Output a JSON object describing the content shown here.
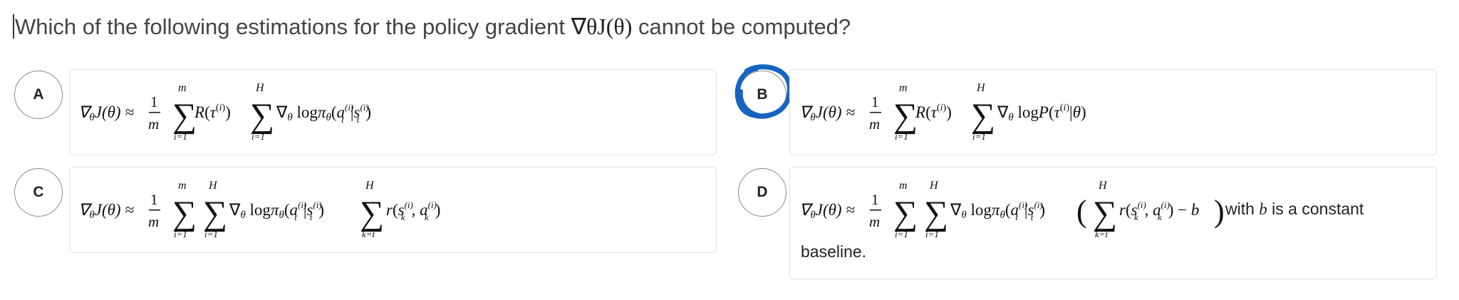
{
  "question": {
    "text_before": "Which of the following estimations for the policy gradient ",
    "math": "∇θJ(θ)",
    "text_after": " cannot be computed?"
  },
  "options": [
    {
      "letter": "A",
      "formula": "∇θJ(θ) ≈ (1/m) Σ_{i=1}^{m} R(τ^(i)) Σ_{i=1}^{H} ∇θ logπθ(a_t^(i)|s_t^(i))"
    },
    {
      "letter": "B",
      "formula": "∇θJ(θ) ≈ (1/m) Σ_{i=1}^{m} R(τ^(i)) Σ_{i=1}^{H} ∇θ logP(τ^(i)|θ)",
      "marked": true
    },
    {
      "letter": "C",
      "formula": "∇θJ(θ) ≈ (1/m) Σ_{i=1}^{m} Σ_{i=1}^{H} ∇θ logπθ(a_t^(i)|s_t^(i)) Σ_{k=t}^{H} r(s_k^(i), a_k^(i))"
    },
    {
      "letter": "D",
      "formula": "∇θJ(θ) ≈ (1/m) Σ_{i=1}^{m} Σ_{i=1}^{H} ∇θ logπθ(a_t^(i)|s_t^(i)) ( Σ_{k=t}^{H} r(s_k^(i), a_k^(i)) − b )",
      "suffix_pre": "with ",
      "suffix_var": "b",
      "suffix_post": " is a constant",
      "continuation": "baseline."
    }
  ],
  "colors": {
    "highlight": "#1565c0",
    "border": "#e3e3e3",
    "text": "#444444"
  }
}
